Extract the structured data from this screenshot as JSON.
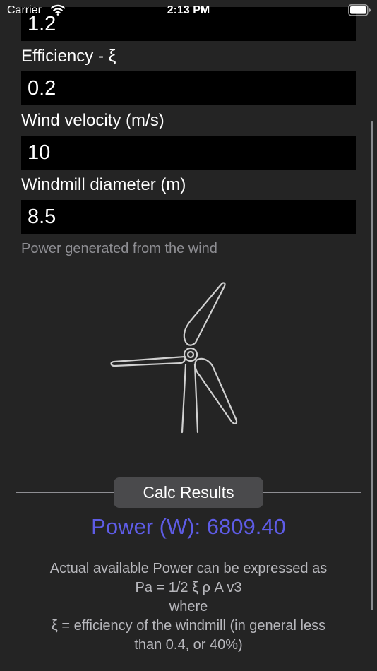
{
  "status_bar": {
    "carrier": "Carrier",
    "time": "2:13 PM"
  },
  "fields": [
    {
      "value": "1.2"
    },
    {
      "label": "Efficiency - ξ",
      "value": "0.2"
    },
    {
      "label": "Wind velocity (m/s)",
      "value": "10"
    },
    {
      "label": "Windmill diameter (m)",
      "value": "8.5"
    }
  ],
  "caption": "Power generated from the wind",
  "illustration": {
    "icon": "wind-turbine-icon"
  },
  "calc_button": {
    "label": "Calc Results"
  },
  "result": {
    "text": "Power (W): 6809.40",
    "color": "#5e5ce6"
  },
  "explanation": {
    "lines": [
      "Actual available Power can be expressed as",
      "Pa = 1/2 ξ ρ A v3",
      "where",
      "ξ = efficiency of the windmill (in general less",
      "than 0.4, or 40%)"
    ]
  },
  "colors": {
    "background": "#242424",
    "field_background": "#000000",
    "secondary_text": "#8e8e93",
    "button_background": "#4a4a4c"
  }
}
